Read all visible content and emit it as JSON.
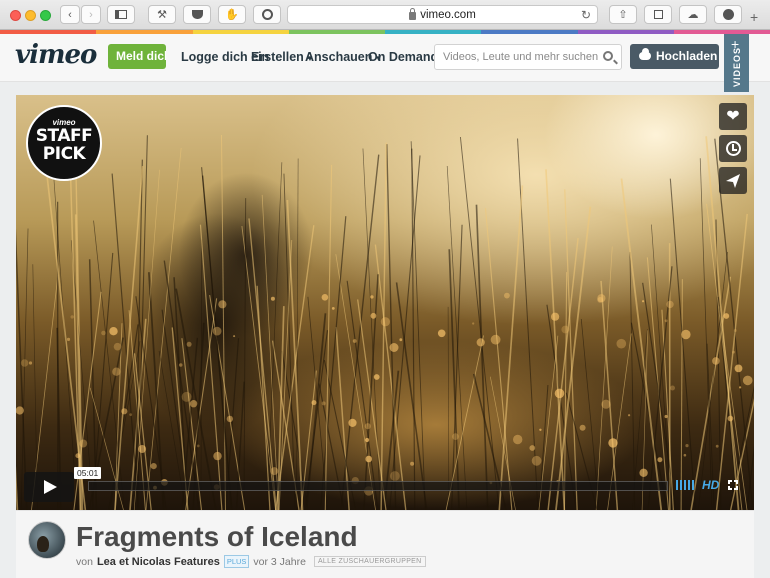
{
  "browser": {
    "url": "vimeo.com",
    "nav_buttons": [
      "back",
      "forward",
      "sidebar",
      "tools",
      "pocket",
      "extension",
      "1password"
    ],
    "right_buttons": [
      "share",
      "tabs-overview",
      "icloud",
      "downloads"
    ],
    "new_tab": "+"
  },
  "header": {
    "logo": "vimeo",
    "join_label": "Meld dich an",
    "login_label": "Logge dich ein",
    "nav": [
      "Erstellen",
      "Anschauen",
      "On Demand"
    ],
    "search_placeholder": "Videos, Leute und mehr suchen",
    "upload_label": "Hochladen",
    "videos_tab": "VIDEOS",
    "videos_plus": "+"
  },
  "player": {
    "badge_small": "vimeo",
    "badge_line1": "STAFF",
    "badge_line2": "PICK",
    "time_tooltip": "05:01",
    "quality": "HD",
    "progress": 0.0
  },
  "video": {
    "title": "Fragments of Iceland",
    "by_prefix": "von",
    "author": "Lea et Nicolas Features",
    "plus_badge": "PLUS",
    "age": "vor 3 Jahre",
    "audience_badge": "ALLE ZUSCHAUERGRUPPEN"
  },
  "colors": {
    "strip": [
      "#f25c45",
      "#f9a13a",
      "#f5d33f",
      "#7cc35e",
      "#36b1c4",
      "#4c7ac4",
      "#8f5bc3",
      "#e25a94"
    ],
    "join": "#6fb33b",
    "upload": "#4a5a66",
    "accent": "#47a9e6"
  }
}
